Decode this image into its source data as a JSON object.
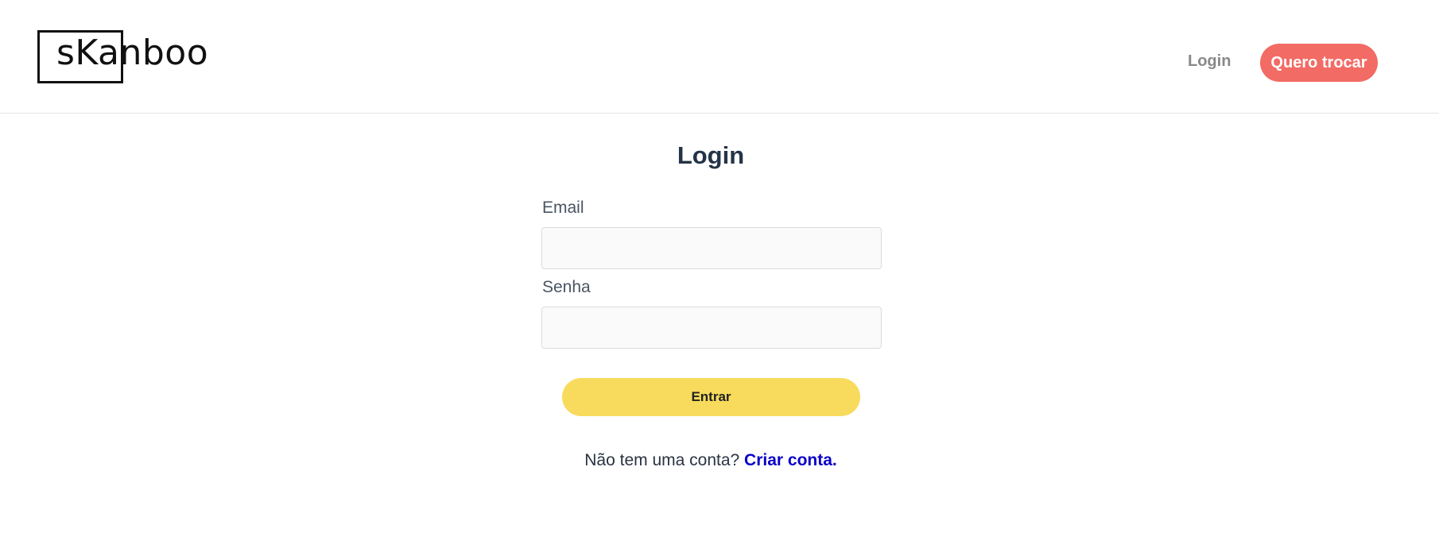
{
  "header": {
    "logo_text": "sKanboo",
    "nav_login_label": "Login",
    "cta_label": "Quero trocar"
  },
  "colors": {
    "cta_background": "#f26b64",
    "submit_background": "#f8db5c",
    "link": "#0a00c8",
    "title": "#243447"
  },
  "login_form": {
    "title": "Login",
    "email_label": "Email",
    "email_value": "",
    "password_label": "Senha",
    "password_value": "",
    "submit_label": "Entrar"
  },
  "signup": {
    "prompt": "Não tem uma conta?",
    "link_label": "Criar conta."
  }
}
